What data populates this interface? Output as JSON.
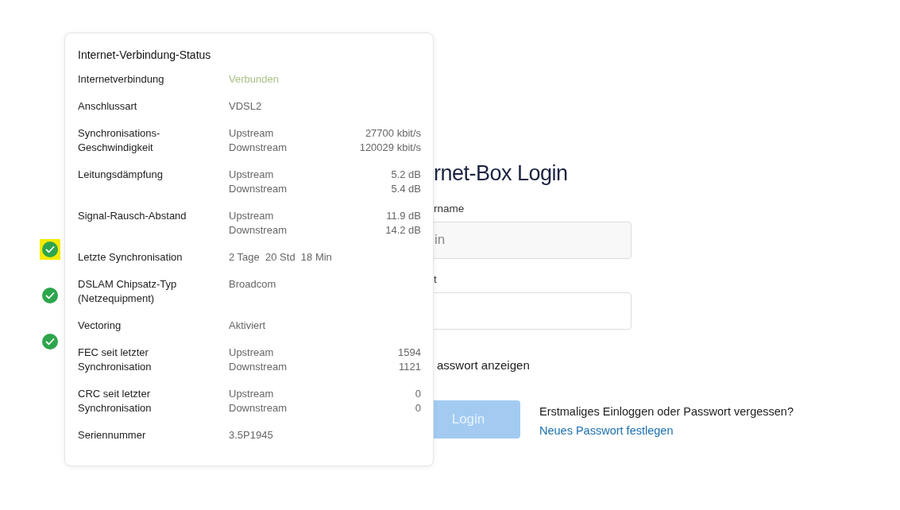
{
  "status_icons": [
    {
      "highlighted": true
    },
    {
      "highlighted": false
    },
    {
      "highlighted": false
    }
  ],
  "login": {
    "title": "rnet-Box Login",
    "username_label": "rname",
    "username_value": "in",
    "password_label": "t",
    "show_password_label": "asswort anzeigen",
    "login_button": {
      "label": "Login",
      "disabled": true
    },
    "help_text": "Erstmaliges Einloggen oder Passwort vergessen?",
    "help_link": "Neues Passwort festlegen"
  },
  "popup": {
    "title": "Internet-Verbindung-Status",
    "rows": [
      {
        "kind": "status",
        "label": "Internetverbindung",
        "value": "Verbunden"
      },
      {
        "kind": "single",
        "label": "Anschlussart",
        "value": "VDSL2"
      },
      {
        "kind": "streams",
        "label": "Synchronisations-\nGeschwindigkeit",
        "streams": [
          {
            "name": "Upstream",
            "value": "27700 kbit/s"
          },
          {
            "name": "Downstream",
            "value": "120029 kbit/s"
          }
        ]
      },
      {
        "kind": "streams",
        "label": "Leitungsdämpfung",
        "streams": [
          {
            "name": "Upstream",
            "value": "5.2 dB"
          },
          {
            "name": "Downstream",
            "value": "5.4 dB"
          }
        ]
      },
      {
        "kind": "streams",
        "label": "Signal-Rausch-Abstand",
        "streams": [
          {
            "name": "Upstream",
            "value": "11.9 dB"
          },
          {
            "name": "Downstream",
            "value": "14.2 dB"
          }
        ]
      },
      {
        "kind": "single",
        "label": "Letzte Synchronisation",
        "value": "2 Tage  20 Std  18 Min"
      },
      {
        "kind": "single",
        "label": "DSLAM Chipsatz-Typ\n(Netzequipment)",
        "value": "Broadcom"
      },
      {
        "kind": "single",
        "label": "Vectoring",
        "value": "Aktiviert"
      },
      {
        "kind": "streams",
        "label": "FEC seit letzter\nSynchronisation",
        "streams": [
          {
            "name": "Upstream",
            "value": "1594"
          },
          {
            "name": "Downstream",
            "value": "1121"
          }
        ]
      },
      {
        "kind": "streams",
        "label": "CRC seit letzter\nSynchronisation",
        "streams": [
          {
            "name": "Upstream",
            "value": "0"
          },
          {
            "name": "Downstream",
            "value": "0"
          }
        ]
      },
      {
        "kind": "single",
        "label": "Seriennummer",
        "value": "3.5P1945"
      }
    ]
  }
}
